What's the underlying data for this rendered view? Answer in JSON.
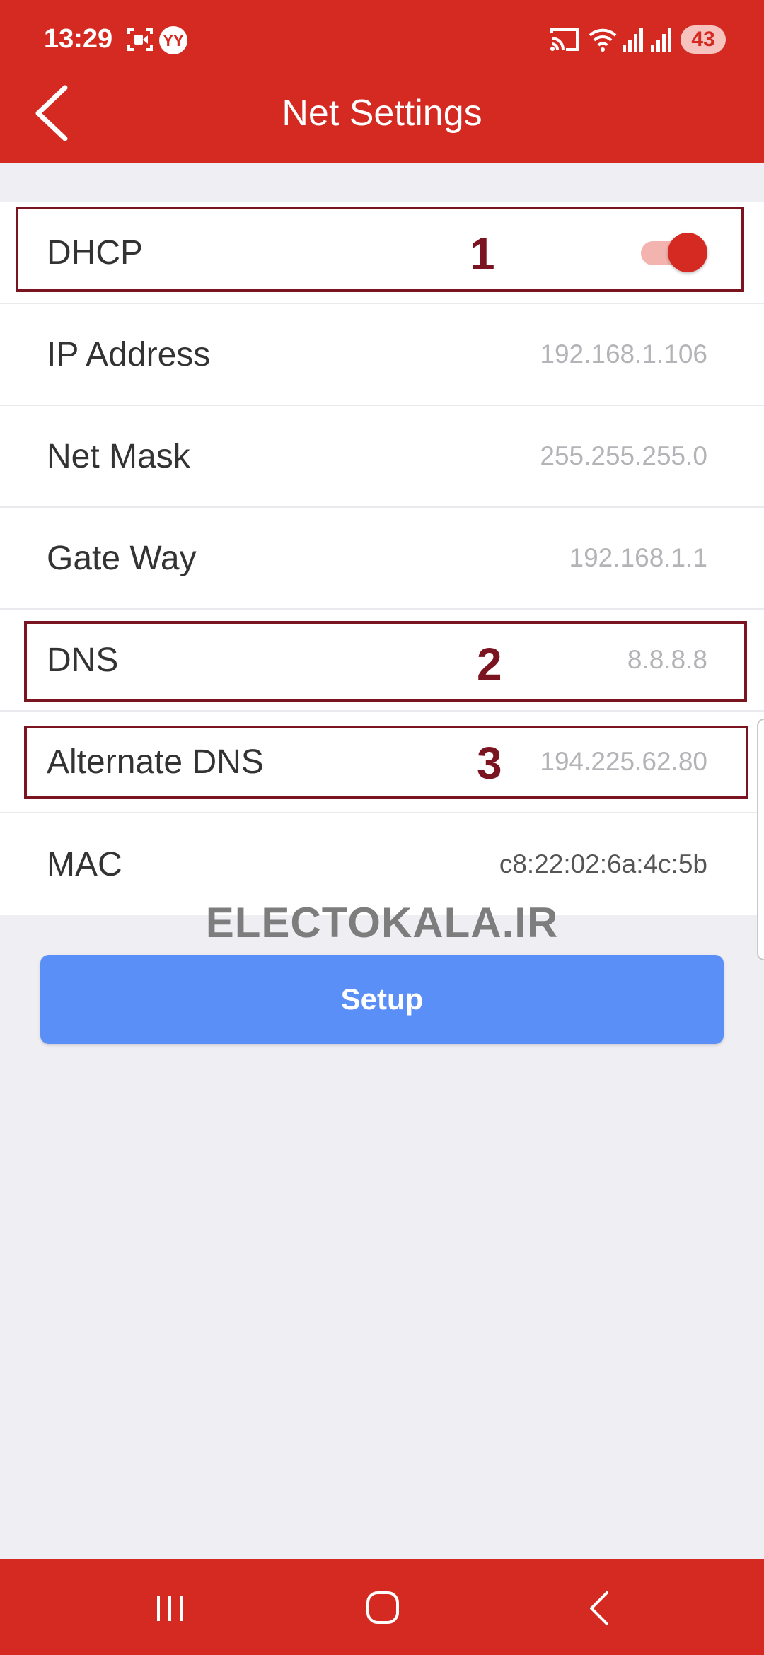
{
  "status_bar": {
    "time": "13:29",
    "left_icons": [
      "screen-record-icon",
      "vpn-badge-icon"
    ],
    "right_icons": [
      "cast-icon",
      "wifi-icon",
      "signal-icon",
      "signal-icon"
    ],
    "battery": "43"
  },
  "header": {
    "title": "Net Settings",
    "back_icon": "chevron-left-icon"
  },
  "settings": {
    "dhcp": {
      "label": "DHCP",
      "enabled": true
    },
    "ip_address": {
      "label": "IP Address",
      "value": "192.168.1.106"
    },
    "net_mask": {
      "label": "Net Mask",
      "value": "255.255.255.0"
    },
    "gate_way": {
      "label": "Gate Way",
      "value": "192.168.1.1"
    },
    "dns": {
      "label": "DNS",
      "value": "8.8.8.8"
    },
    "alt_dns": {
      "label": "Alternate DNS",
      "value": "194.225.62.80"
    },
    "mac": {
      "label": "MAC",
      "value": "c8:22:02:6a:4c:5b"
    }
  },
  "annotations": {
    "n1": "1",
    "n2": "2",
    "n3": "3"
  },
  "watermark": "ELECTOKALA.IR",
  "setup_label": "Setup",
  "nav": {
    "icons": [
      "recent-apps-icon",
      "home-icon",
      "back-icon"
    ]
  },
  "colors": {
    "accent": "#d52a22",
    "button": "#5b8ff8",
    "annotation": "#7a1420",
    "background": "#efeef3"
  }
}
